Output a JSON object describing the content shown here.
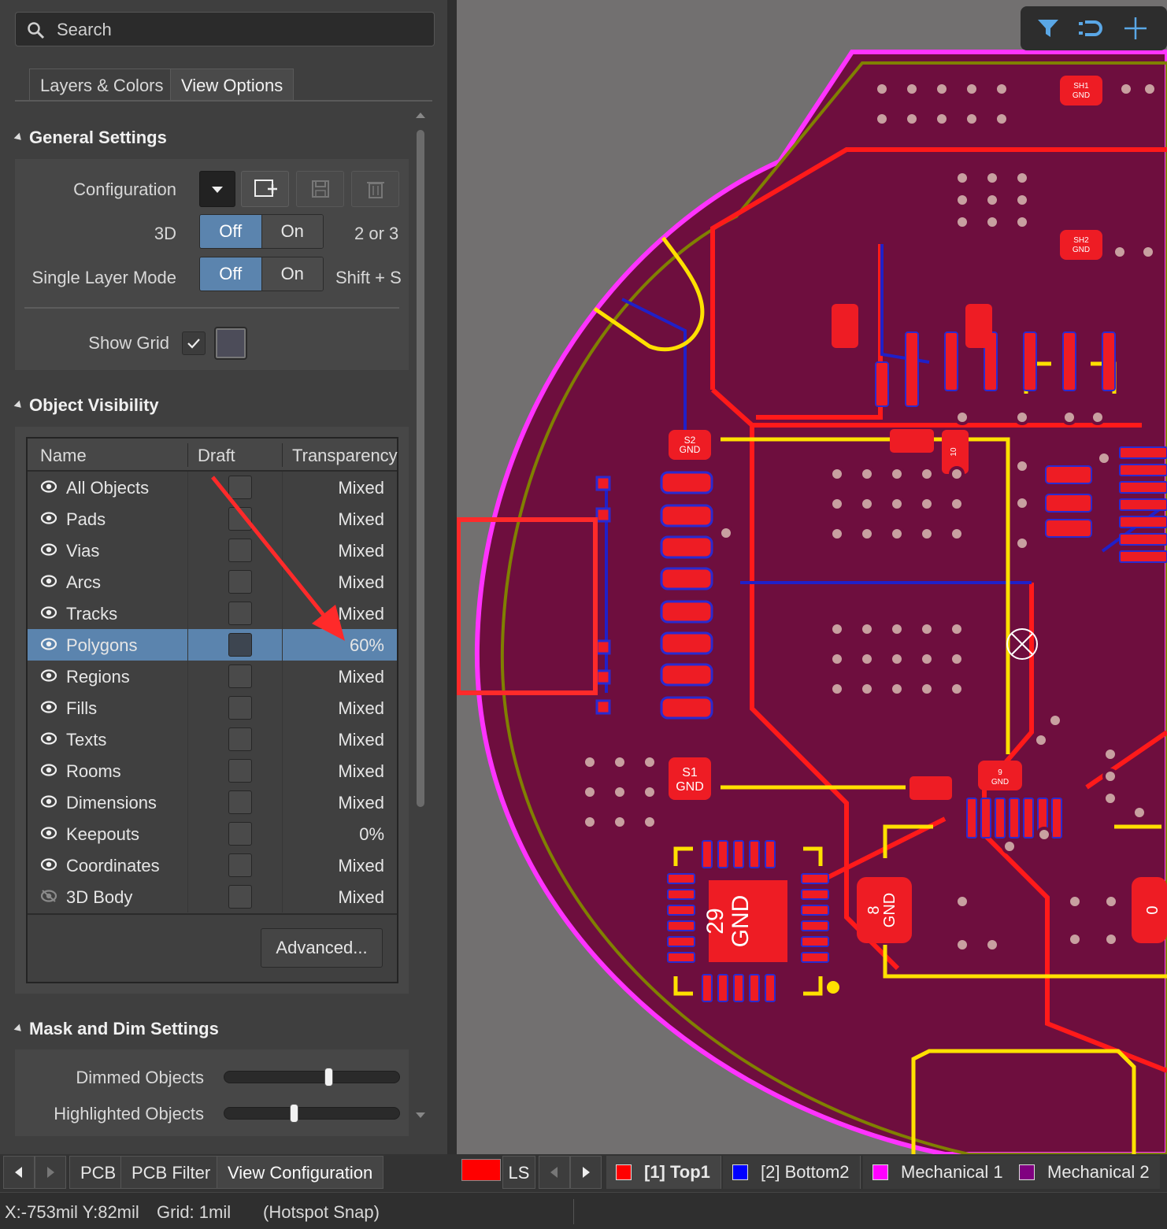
{
  "search": {
    "placeholder": "Search"
  },
  "tabs": [
    {
      "label": "Layers & Colors"
    },
    {
      "label": "View Options"
    }
  ],
  "general": {
    "title": "General Settings",
    "configuration_label": "Configuration",
    "mode_3d_label": "3D",
    "mode_3d_off": "Off",
    "mode_3d_on": "On",
    "mode_3d_shortcut": "2 or 3",
    "single_layer_label": "Single Layer Mode",
    "single_layer_off": "Off",
    "single_layer_on": "On",
    "single_layer_shortcut": "Shift + S",
    "show_grid_label": "Show Grid"
  },
  "visibility": {
    "title": "Object Visibility",
    "columns": {
      "name": "Name",
      "draft": "Draft",
      "transparency": "Transparency"
    },
    "rows": [
      {
        "name": "All Objects",
        "transparency": "Mixed"
      },
      {
        "name": "Pads",
        "transparency": "Mixed"
      },
      {
        "name": "Vias",
        "transparency": "Mixed"
      },
      {
        "name": "Arcs",
        "transparency": "Mixed"
      },
      {
        "name": "Tracks",
        "transparency": "Mixed"
      },
      {
        "name": "Polygons",
        "transparency": "60%"
      },
      {
        "name": "Regions",
        "transparency": "Mixed"
      },
      {
        "name": "Fills",
        "transparency": "Mixed"
      },
      {
        "name": "Texts",
        "transparency": "Mixed"
      },
      {
        "name": "Rooms",
        "transparency": "Mixed"
      },
      {
        "name": "Dimensions",
        "transparency": "Mixed"
      },
      {
        "name": "Keepouts",
        "transparency": "0%"
      },
      {
        "name": "Coordinates",
        "transparency": "Mixed"
      },
      {
        "name": "3D Body",
        "transparency": "Mixed"
      }
    ],
    "advanced_button": "Advanced..."
  },
  "mask": {
    "title": "Mask and Dim Settings",
    "dimmed_label": "Dimmed Objects",
    "dimmed_value": 0.6,
    "highlighted_label": "Highlighted Objects",
    "highlighted_value": 0.4
  },
  "panel_tabs": [
    {
      "label": "PCB"
    },
    {
      "label": "PCB Filter"
    },
    {
      "label": "View Configuration"
    }
  ],
  "layer_bar": {
    "ls_label": "LS",
    "layers": [
      {
        "label": "[1] Top1",
        "color": "#ff0000"
      },
      {
        "label": "[2] Bottom2",
        "color": "#0000ff"
      },
      {
        "label": "Mechanical 1",
        "color": "#ff00ff"
      },
      {
        "label": "Mechanical 2",
        "color": "#800080"
      }
    ]
  },
  "status": {
    "coords": "X:-753mil Y:82mil",
    "grid": "Grid: 1mil",
    "snap": "(Hotspot Snap)"
  },
  "pcb_labels": {
    "sh1": "SH1",
    "sh2": "SH2",
    "gnd": "GND",
    "s1": "S1",
    "s2": "S2",
    "n29": "29",
    "n10": "10",
    "n9": "9",
    "n8": "8",
    "n0": "0"
  },
  "colors": {
    "accent": "#5b84ae",
    "board": "#6e0e3e",
    "top_layer": "#ff0000",
    "bottom_layer": "#0000ff",
    "mechanical_1": "#ff00ff",
    "mechanical_2": "#800080",
    "annotation": "#ff2a2a"
  }
}
